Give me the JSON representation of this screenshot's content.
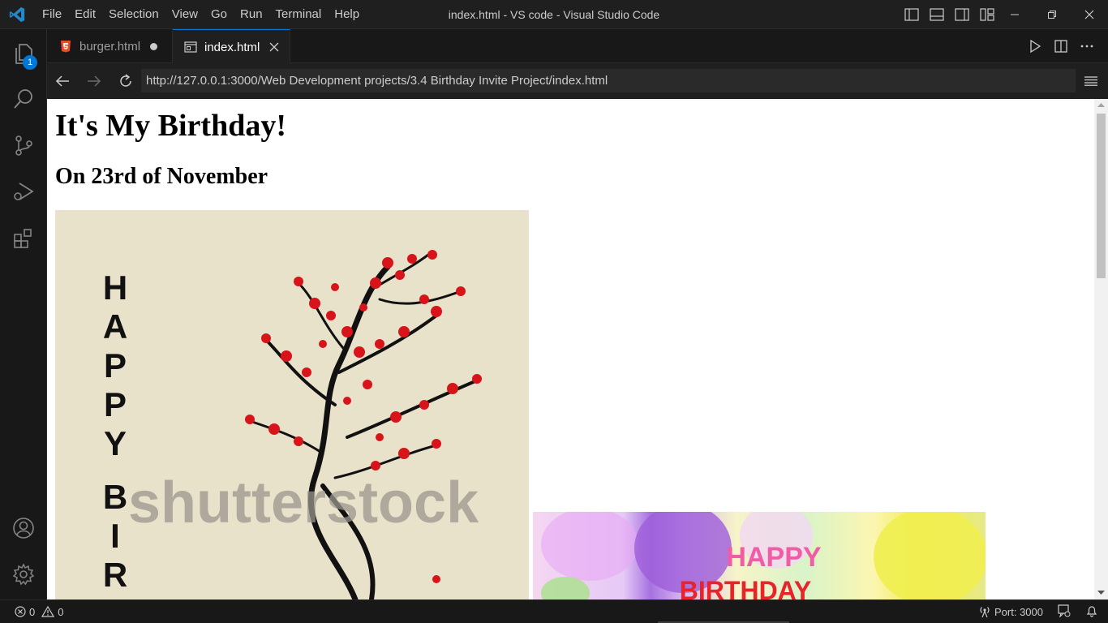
{
  "menu": [
    "File",
    "Edit",
    "Selection",
    "View",
    "Go",
    "Run",
    "Terminal",
    "Help"
  ],
  "window_title": "index.html - VS code - Visual Studio Code",
  "activity": {
    "explorer_badge": "1"
  },
  "tabs": [
    {
      "label": "burger.html",
      "state": "modified"
    },
    {
      "label": "index.html",
      "state": "active"
    }
  ],
  "browser": {
    "url": "http://127.0.0.1:3000/Web Development projects/3.4 Birthday Invite Project/index.html"
  },
  "page": {
    "heading": "It's My Birthday!",
    "subheading": "On 23rd of November",
    "image1": {
      "vertical_text": "HAPPY BIRT",
      "watermark": "shutterstock"
    },
    "image2": {
      "line1": "HAPPY",
      "line2": "BIRTHDAY"
    }
  },
  "status": {
    "errors": "0",
    "warnings": "0",
    "port": "Port: 3000"
  },
  "colors": {
    "accent": "#0078d4",
    "html_icon": "#e44d26"
  }
}
